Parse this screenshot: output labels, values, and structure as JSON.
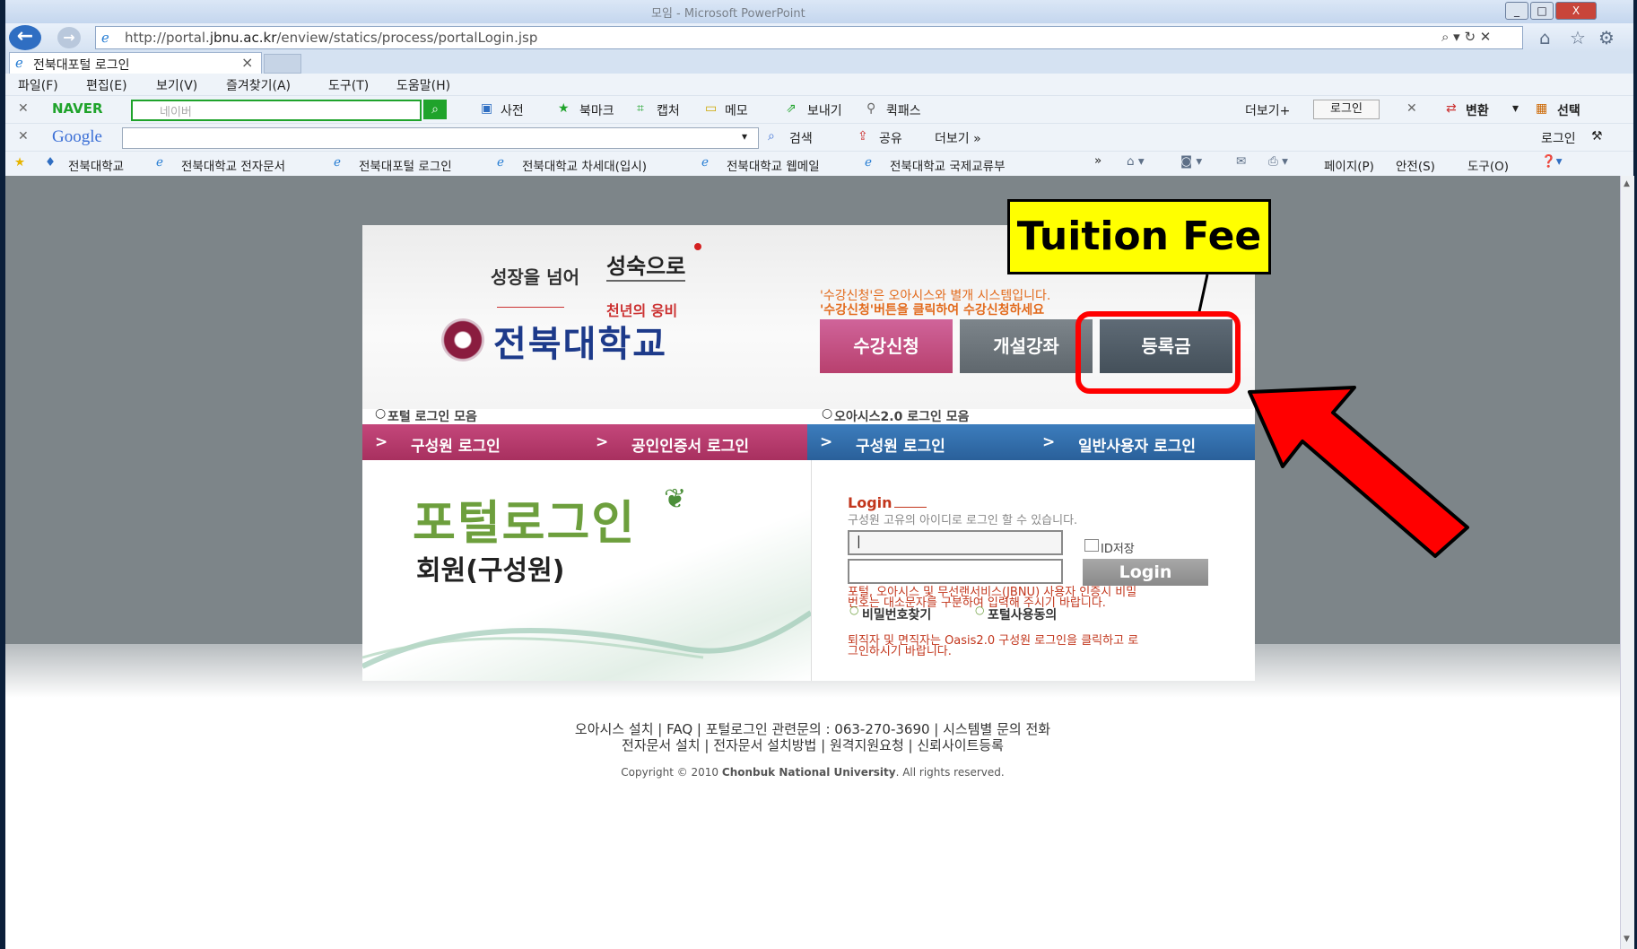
{
  "window": {
    "title": "모임 - Microsoft PowerPoint",
    "controls": [
      "_",
      "□",
      "X"
    ]
  },
  "address_bar": {
    "url_prefix": "http://portal.",
    "url_domain": "jbnu.ac.kr",
    "url_path": "/enview/statics/process/portalLogin.jsp",
    "tools": "⌕ ▾ ↻ ✕"
  },
  "tab": {
    "label": "전북대포털 로그인",
    "close": "×"
  },
  "menu": [
    "파일(F)",
    "편집(E)",
    "보기(V)",
    "즐겨찾기(A)",
    "도구(T)",
    "도움말(H)"
  ],
  "naver_toolbar": {
    "logo": "NAVER",
    "search_placeholder": "네이버",
    "items": [
      "사전",
      "북마크",
      "캡처",
      "메모",
      "보내기",
      "퀵패스"
    ],
    "right_more": "더보기+",
    "right_login": "로그인",
    "right_items": [
      "변환",
      "선택"
    ]
  },
  "google_toolbar": {
    "logo": "Google",
    "items": [
      "검색",
      "공유",
      "더보기 »"
    ],
    "right_login": "로그인"
  },
  "favorites": {
    "items": [
      "전북대학교",
      "전북대학교 전자문서",
      "전북대포털 로그인",
      "전북대학교 차세대(입시)",
      "전북대학교 웹메일",
      "전북대학교 국제교류부"
    ],
    "overflow": "»",
    "commands": [
      "페이지(P)",
      "안전(S)",
      "도구(O)"
    ]
  },
  "portal": {
    "slogan_left": "성장을 넘어",
    "slogan_right": "성숙으로",
    "subtitle": "천년의 웅비",
    "university_name": "전북대학교",
    "notice_line1": "'수강신청'은 오아시스와 별개 시스템입니다.",
    "notice_line2": "'수강신청'버튼을 클릭하여 수강신청하세요",
    "buttons": {
      "enroll": "수강신청",
      "courses": "개설강좌",
      "tuition": "등록금"
    },
    "section_portal": "포털 로그인 모음",
    "section_oasis": "오아시스2.0 로그인 모음",
    "ribbon": [
      "구성원 로그인",
      "공인인증서 로그인",
      "구성원 로그인",
      "일반사용자 로그인"
    ],
    "ribbon_arrow": ">",
    "banner_title": "포털로그인",
    "banner_sub": "회원(구성원)",
    "login": {
      "heading": "Login",
      "description": "구성원 고유의 아이디로 로그인 할 수 있습니다.",
      "id_value": "|",
      "save_id_label": "ID저장",
      "submit": "Login",
      "notice_line1": "포털, 오아시스 및 무선랜서비스(JBNU) 사용자 인증시 비밀",
      "notice_line2": "번호는 대소문자를 구분하여 입력해 주시기 바랍니다.",
      "link_find_pw": "비밀번호찾기",
      "link_agree": "포털사용동의",
      "retire_line1": "퇴직자 및 면직자는 Oasis2.0 구성원 로그인을 클릭하고 로",
      "retire_line2": "그인하시기 바랍니다."
    }
  },
  "footer": {
    "line1": "오아시스 설치 | FAQ | 포털로그인 관련문의 : 063-270-3690 | 시스템별 문의 전화",
    "line2": "전자문서 설치 | 전자문서 설치방법 | 원격지원요청 | 신뢰사이트등록",
    "copyright_prefix": "Copyright © 2010",
    "copyright_org": "Chonbuk National University",
    "copyright_suffix": ". All rights reserved."
  },
  "annotation": {
    "callout": "Tuition Fee"
  },
  "colors": {
    "enroll": "#c44d7f",
    "courses": "#6b7278",
    "tuition": "#4f5b66",
    "ribbon_left": "#b5346a",
    "ribbon_right": "#2d6aa6",
    "highlight": "#ff0000",
    "callout": "#ffff00"
  }
}
